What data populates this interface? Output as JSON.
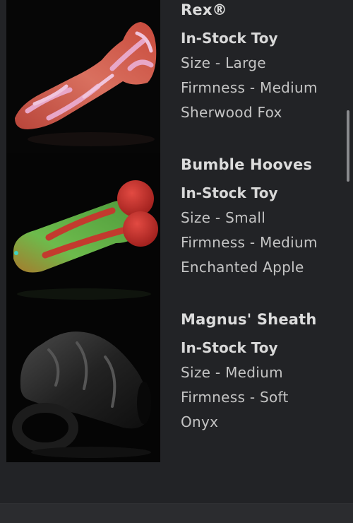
{
  "products": [
    {
      "name": "Rex®",
      "stock": "In-Stock Toy",
      "size": "Size - Large",
      "firmness": "Firmness - Medium",
      "color": "Sherwood Fox",
      "image_palette": [
        "#c9503e",
        "#e8a7c8"
      ]
    },
    {
      "name": "Bumble Hooves",
      "stock": "In-Stock Toy",
      "size": "Size - Small",
      "firmness": "Firmness - Medium",
      "color": "Enchanted Apple",
      "image_palette": [
        "#5fb04a",
        "#c8342e"
      ]
    },
    {
      "name": "Magnus' Sheath",
      "stock": "In-Stock Toy",
      "size": "Size - Medium",
      "firmness": "Firmness - Soft",
      "color": "Onyx",
      "image_palette": [
        "#1a1a1a",
        "#3a3a3a"
      ]
    }
  ]
}
